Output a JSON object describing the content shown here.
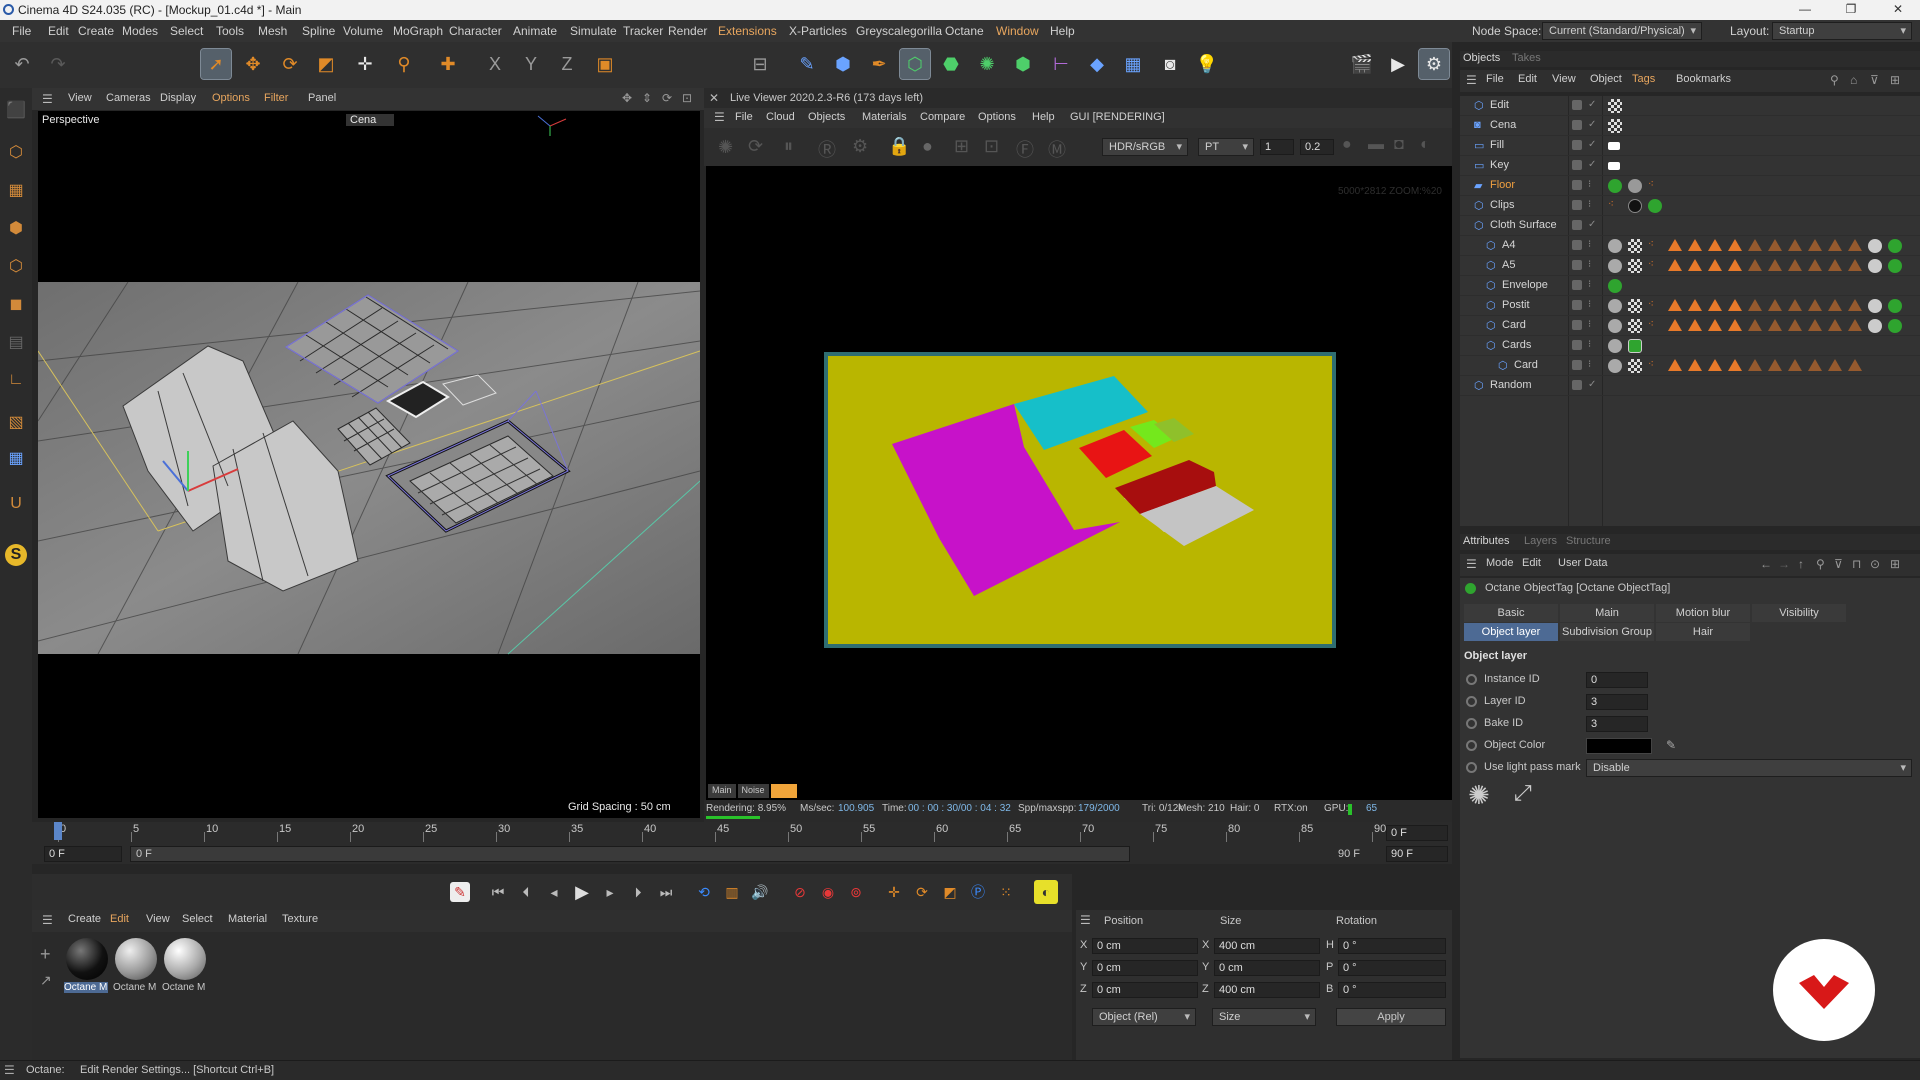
{
  "window": {
    "title": "Cinema 4D S24.035 (RC) - [Mockup_01.c4d *] - Main",
    "controls": [
      "—",
      "❐",
      "✕"
    ]
  },
  "menubar": {
    "items": [
      "File",
      "Edit",
      "Create",
      "Modes",
      "Select",
      "Tools",
      "Mesh",
      "Spline",
      "Volume",
      "MoGraph",
      "Character",
      "Animate",
      "Simulate",
      "Tracker",
      "Render",
      "Extensions",
      "X-Particles",
      "Greyscalegorilla",
      "Octane",
      "Window",
      "Help"
    ],
    "highlighted": [
      "Extensions",
      "Window"
    ],
    "node_space_label": "Node Space:",
    "node_space_value": "Current (Standard/Physical)",
    "layout_label": "Layout:",
    "layout_value": "Startup"
  },
  "viewport": {
    "menu": [
      "View",
      "Cameras",
      "Display",
      "Options",
      "Filter",
      "Panel"
    ],
    "highlighted": [
      "Options",
      "Filter"
    ],
    "camera_label": "Perspective",
    "camera_name": "Cena",
    "grid_spacing": "Grid Spacing : 50 cm"
  },
  "live_viewer": {
    "title": "Live Viewer 2020.2.3-R6 (173 days left)",
    "menu": [
      "File",
      "Cloud",
      "Objects",
      "Materials",
      "Compare",
      "Options",
      "Help",
      "GUI [RENDERING]"
    ],
    "color_space": "HDR/sRGB",
    "kernel": "PT",
    "value1": "1",
    "value2": "0.2",
    "resolution_overlay": "5000*2812 ZOOM:%20",
    "bottom_tabs": [
      "Main",
      "Noise",
      ""
    ],
    "status": {
      "rendering": "Rendering: 8.95%",
      "ms_sec_label": "Ms/sec:",
      "ms_sec": "100.905",
      "time_label": "Time:",
      "time": "00 : 00 : 30/00 : 04 : 32",
      "spp_label": "Spp/maxspp:",
      "spp": "179/2000",
      "tri": "Tri: 0/12k",
      "mesh": "Mesh: 210",
      "hair": "Hair: 0",
      "rtx": "RTX:on",
      "gpu_label": "GPU:",
      "gpu": "65"
    },
    "progress": 0.0895
  },
  "objects_panel": {
    "tabs": [
      "Objects",
      "Takes"
    ],
    "menu": [
      "File",
      "Edit",
      "View",
      "Object",
      "Tags",
      "Bookmarks"
    ],
    "rows": [
      {
        "name": "Edit",
        "indent": 0,
        "color": "normal",
        "tags": "checker2"
      },
      {
        "name": "Cena",
        "indent": 0,
        "color": "normal",
        "tags": "checker2"
      },
      {
        "name": "Fill",
        "indent": 0,
        "color": "normal",
        "tags": "light"
      },
      {
        "name": "Key",
        "indent": 0,
        "color": "normal",
        "tags": "light"
      },
      {
        "name": "Floor",
        "indent": 0,
        "color": "orange",
        "tags": "floor"
      },
      {
        "name": "Clips",
        "indent": 0,
        "color": "normal",
        "tags": "clips"
      },
      {
        "name": "Cloth Surface",
        "indent": 0,
        "color": "normal",
        "tags": "none"
      },
      {
        "name": "A4",
        "indent": 1,
        "color": "normal",
        "tags": "tri_sphere"
      },
      {
        "name": "A5",
        "indent": 1,
        "color": "normal",
        "tags": "tri_sphere"
      },
      {
        "name": "Envelope",
        "indent": 1,
        "color": "normal",
        "tags": "green"
      },
      {
        "name": "Postit",
        "indent": 1,
        "color": "normal",
        "tags": "tri_sphere"
      },
      {
        "name": "Card",
        "indent": 1,
        "color": "normal",
        "tags": "tri_sphere"
      },
      {
        "name": "Cards",
        "indent": 1,
        "color": "normal",
        "tags": "cards"
      },
      {
        "name": "Card",
        "indent": 2,
        "color": "normal",
        "tags": "tri"
      },
      {
        "name": "Random",
        "indent": 0,
        "color": "normal",
        "tags": "none"
      }
    ]
  },
  "attributes_panel": {
    "tabs": [
      "Attributes",
      "Layers",
      "Structure"
    ],
    "menu": [
      "Mode",
      "Edit",
      "User Data"
    ],
    "tag_title": "Octane ObjectTag [Octane ObjectTag]",
    "tag_tabs_row1": [
      "Basic",
      "Main",
      "Motion blur",
      "Visibility"
    ],
    "tag_tabs_row2": [
      "Object layer",
      "Subdivision Group",
      "Hair"
    ],
    "active_tab": "Object layer",
    "section": "Object layer",
    "fields": [
      {
        "label": "Instance ID",
        "value": "0"
      },
      {
        "label": "Layer ID",
        "value": "3"
      },
      {
        "label": "Bake ID",
        "value": "3"
      },
      {
        "label": "Object Color",
        "value": ""
      },
      {
        "label": "Use light pass mark",
        "value": "Disable"
      }
    ]
  },
  "timeline": {
    "ticks": [
      "0",
      "5",
      "10",
      "15",
      "20",
      "25",
      "30",
      "35",
      "40",
      "45",
      "50",
      "55",
      "60",
      "65",
      "70",
      "75",
      "80",
      "85",
      "90"
    ],
    "current_frame": "0 F",
    "start": "0 F",
    "range_start": "0 F",
    "range_end": "90 F",
    "end": "90 F"
  },
  "material_manager": {
    "menu": [
      "Create",
      "Edit",
      "View",
      "Select",
      "Material",
      "Texture"
    ],
    "highlighted": [
      "Edit"
    ],
    "materials": [
      {
        "label": "Octane M",
        "tone": "dark"
      },
      {
        "label": "Octane M",
        "tone": "light"
      },
      {
        "label": "Octane M",
        "tone": "light2"
      }
    ]
  },
  "coordinates": {
    "headers": [
      "Position",
      "Size",
      "Rotation"
    ],
    "rows": [
      {
        "axis": "X",
        "pos": "0 cm",
        "size_axis": "X",
        "size": "400 cm",
        "rot_axis": "H",
        "rot": "0 °"
      },
      {
        "axis": "Y",
        "pos": "0 cm",
        "size_axis": "Y",
        "size": "0 cm",
        "rot_axis": "P",
        "rot": "0 °"
      },
      {
        "axis": "Z",
        "pos": "0 cm",
        "size_axis": "Z",
        "size": "400 cm",
        "rot_axis": "B",
        "rot": "0 °"
      }
    ],
    "mode": "Object (Rel)",
    "size_mode": "Size",
    "apply": "Apply"
  },
  "statusbar": {
    "label": "Octane:",
    "message": "Edit Render Settings... [Shortcut Ctrl+B]"
  },
  "colors": {
    "accent": "#e08a28",
    "active_tab": "#4d6a94",
    "render_bg": "#b9b600",
    "render_frame": "#2f6e72"
  }
}
